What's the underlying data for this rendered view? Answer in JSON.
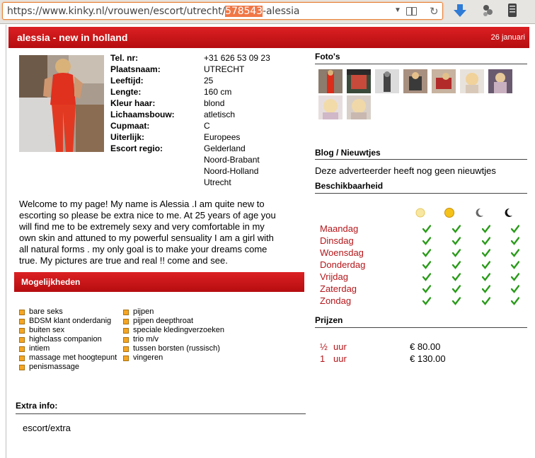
{
  "browser": {
    "url_prefix": "https://www.kinky.nl/vrouwen/escort/utrecht/",
    "url_selected": "578543",
    "url_suffix": "-alessia"
  },
  "header": {
    "title": "alessia - new in holland",
    "date": "26 januari"
  },
  "profile": {
    "attributes": [
      {
        "label": "Tel. nr:",
        "value": "+31 626 53 09 23"
      },
      {
        "label": "Plaatsnaam:",
        "value": "UTRECHT"
      },
      {
        "label": "Leeftijd:",
        "value": "25"
      },
      {
        "label": "Lengte:",
        "value": "160 cm"
      },
      {
        "label": "Kleur haar:",
        "value": "blond"
      },
      {
        "label": "Lichaamsbouw:",
        "value": "atletisch"
      },
      {
        "label": "Cupmaat:",
        "value": "C"
      },
      {
        "label": "Uiterlijk:",
        "value": "Europees"
      },
      {
        "label": "Escort regio:",
        "value": "Gelderland"
      }
    ],
    "regions_extra": [
      "Noord-Brabant",
      "Noord-Holland",
      "Utrecht"
    ],
    "description": "Welcome to my page! My name is Alessia .I am quite new to escorting so please be extra nice to me. At 25 years of age you will find me to be extremely sexy and very comfortable in my own skin and attuned to my powerful sensuality I am a girl with all natural forms . my only goal is to make your dreams come true. My pictures are true and real !! come and see."
  },
  "mogelijkheden": {
    "title": "Mogelijkheden",
    "col1": [
      "bare seks",
      "BDSM klant onderdanig",
      "buiten sex",
      "highclass companion",
      "intiem",
      "massage met hoogtepunt",
      "penismassage"
    ],
    "col2": [
      "pijpen",
      "pijpen deepthroat",
      "speciale kledingverzoeken",
      "trio m/v",
      "tussen borsten (russisch)",
      "vingeren"
    ]
  },
  "extra": {
    "title": "Extra info:",
    "value": "escort/extra"
  },
  "photos": {
    "title": "Foto's"
  },
  "blog": {
    "title": "Blog / Nieuwtjes",
    "text": "Deze adverteerder heeft nog geen nieuwtjes"
  },
  "availability": {
    "title": "Beschikbaarheid",
    "days": [
      "Maandag",
      "Dinsdag",
      "Woensdag",
      "Donderdag",
      "Vrijdag",
      "Zaterdag",
      "Zondag"
    ]
  },
  "prices": {
    "title": "Prijzen",
    "rows": [
      {
        "amount": "½",
        "unit": "uur",
        "price": "€ 80.00"
      },
      {
        "amount": "1",
        "unit": "uur",
        "price": "€ 130.00"
      }
    ]
  },
  "colors": {
    "header_red": "#c8171a",
    "day_red": "#b5161a",
    "check_green": "#2a9a1a"
  }
}
